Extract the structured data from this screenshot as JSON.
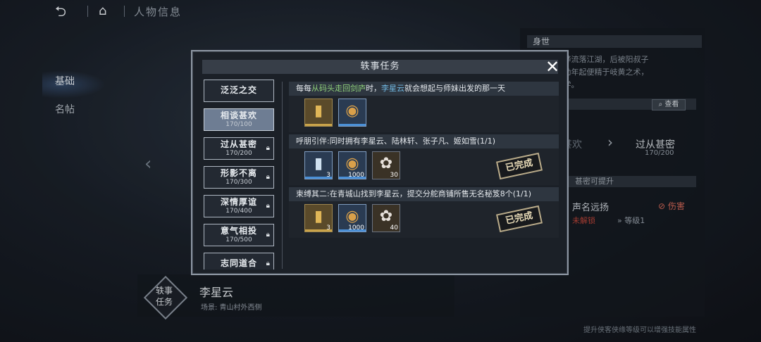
{
  "header": {
    "back_icon": "back-arrow-icon",
    "home_icon": "home-icon",
    "title": "人物信息"
  },
  "left_nav": {
    "items": [
      {
        "label": "基础",
        "active": true
      },
      {
        "label": "名帖",
        "active": false
      }
    ]
  },
  "character": {
    "badge_line1": "轶事",
    "badge_line2": "任务",
    "name": "李星云",
    "location": "场景: 青山村外西侧"
  },
  "right_panel": {
    "section1_title": "身世",
    "section1_text": [
      "...，随李烨流落江湖，后被阳叔子",
      "...庐，自幼年起便精于岐黄之术，",
      "...所授武学。"
    ],
    "search_label": "查看",
    "level_current": "相谈甚欢",
    "level_next": "过从甚密",
    "level_next_progress": "170/200",
    "section3_title": "甚密可提升",
    "skill_name": "声名远扬",
    "skill_tag": "伤害",
    "skill_lock": "未解锁",
    "skill_level": "等级1",
    "bottom_hint": "提升侠客侠缘等级可以增强技能属性"
  },
  "modal": {
    "title": "轶事任务",
    "close_icon": "close-icon",
    "tabs": [
      {
        "label": "泛泛之交",
        "progress": "",
        "locked": false,
        "active": false
      },
      {
        "label": "相谈甚欢",
        "progress": "170/100",
        "locked": false,
        "active": true
      },
      {
        "label": "过从甚密",
        "progress": "170/200",
        "locked": true,
        "active": false
      },
      {
        "label": "形影不离",
        "progress": "170/300",
        "locked": true,
        "active": false
      },
      {
        "label": "深情厚谊",
        "progress": "170/400",
        "locked": true,
        "active": false
      },
      {
        "label": "意气相投",
        "progress": "170/500",
        "locked": true,
        "active": false
      },
      {
        "label": "志同道合",
        "progress": "",
        "locked": true,
        "active": false
      }
    ],
    "quests": [
      {
        "head_parts": [
          {
            "text": "每每",
            "style": ""
          },
          {
            "text": "从码头走回剑庐",
            "style": "hl-green"
          },
          {
            "text": "时，",
            "style": ""
          },
          {
            "text": "李星云",
            "style": "hl-blue"
          },
          {
            "text": "就会想起与师妹出发的那一天",
            "style": ""
          }
        ],
        "rewards": [
          {
            "icon": "gold-token-icon",
            "count": "",
            "rarity": "gold"
          },
          {
            "icon": "copper-coin-icon",
            "count": "",
            "rarity": "blue"
          }
        ],
        "completed": false,
        "stamp": ""
      },
      {
        "head_parts": [
          {
            "text": "呼朋引伴:同时拥有李星云、陆林轩、张子凡、姬如雪(1/1)",
            "style": ""
          }
        ],
        "rewards": [
          {
            "icon": "silver-token-icon",
            "count": "3",
            "rarity": "blue"
          },
          {
            "icon": "copper-coin-icon",
            "count": "1000",
            "rarity": "blue"
          },
          {
            "icon": "meat-bun-icon",
            "count": "30",
            "rarity": "plain"
          }
        ],
        "completed": true,
        "stamp": "已完成"
      },
      {
        "head_parts": [
          {
            "text": "束缚其二:在青城山找到李星云，提交分舵商铺所售无名秘笈8个(1/1)",
            "style": ""
          }
        ],
        "rewards": [
          {
            "icon": "gold-token-icon",
            "count": "3",
            "rarity": "gold"
          },
          {
            "icon": "copper-coin-icon",
            "count": "1000",
            "rarity": "blue"
          },
          {
            "icon": "meat-bun-icon",
            "count": "40",
            "rarity": "plain"
          }
        ],
        "completed": true,
        "stamp": "已完成"
      }
    ]
  }
}
